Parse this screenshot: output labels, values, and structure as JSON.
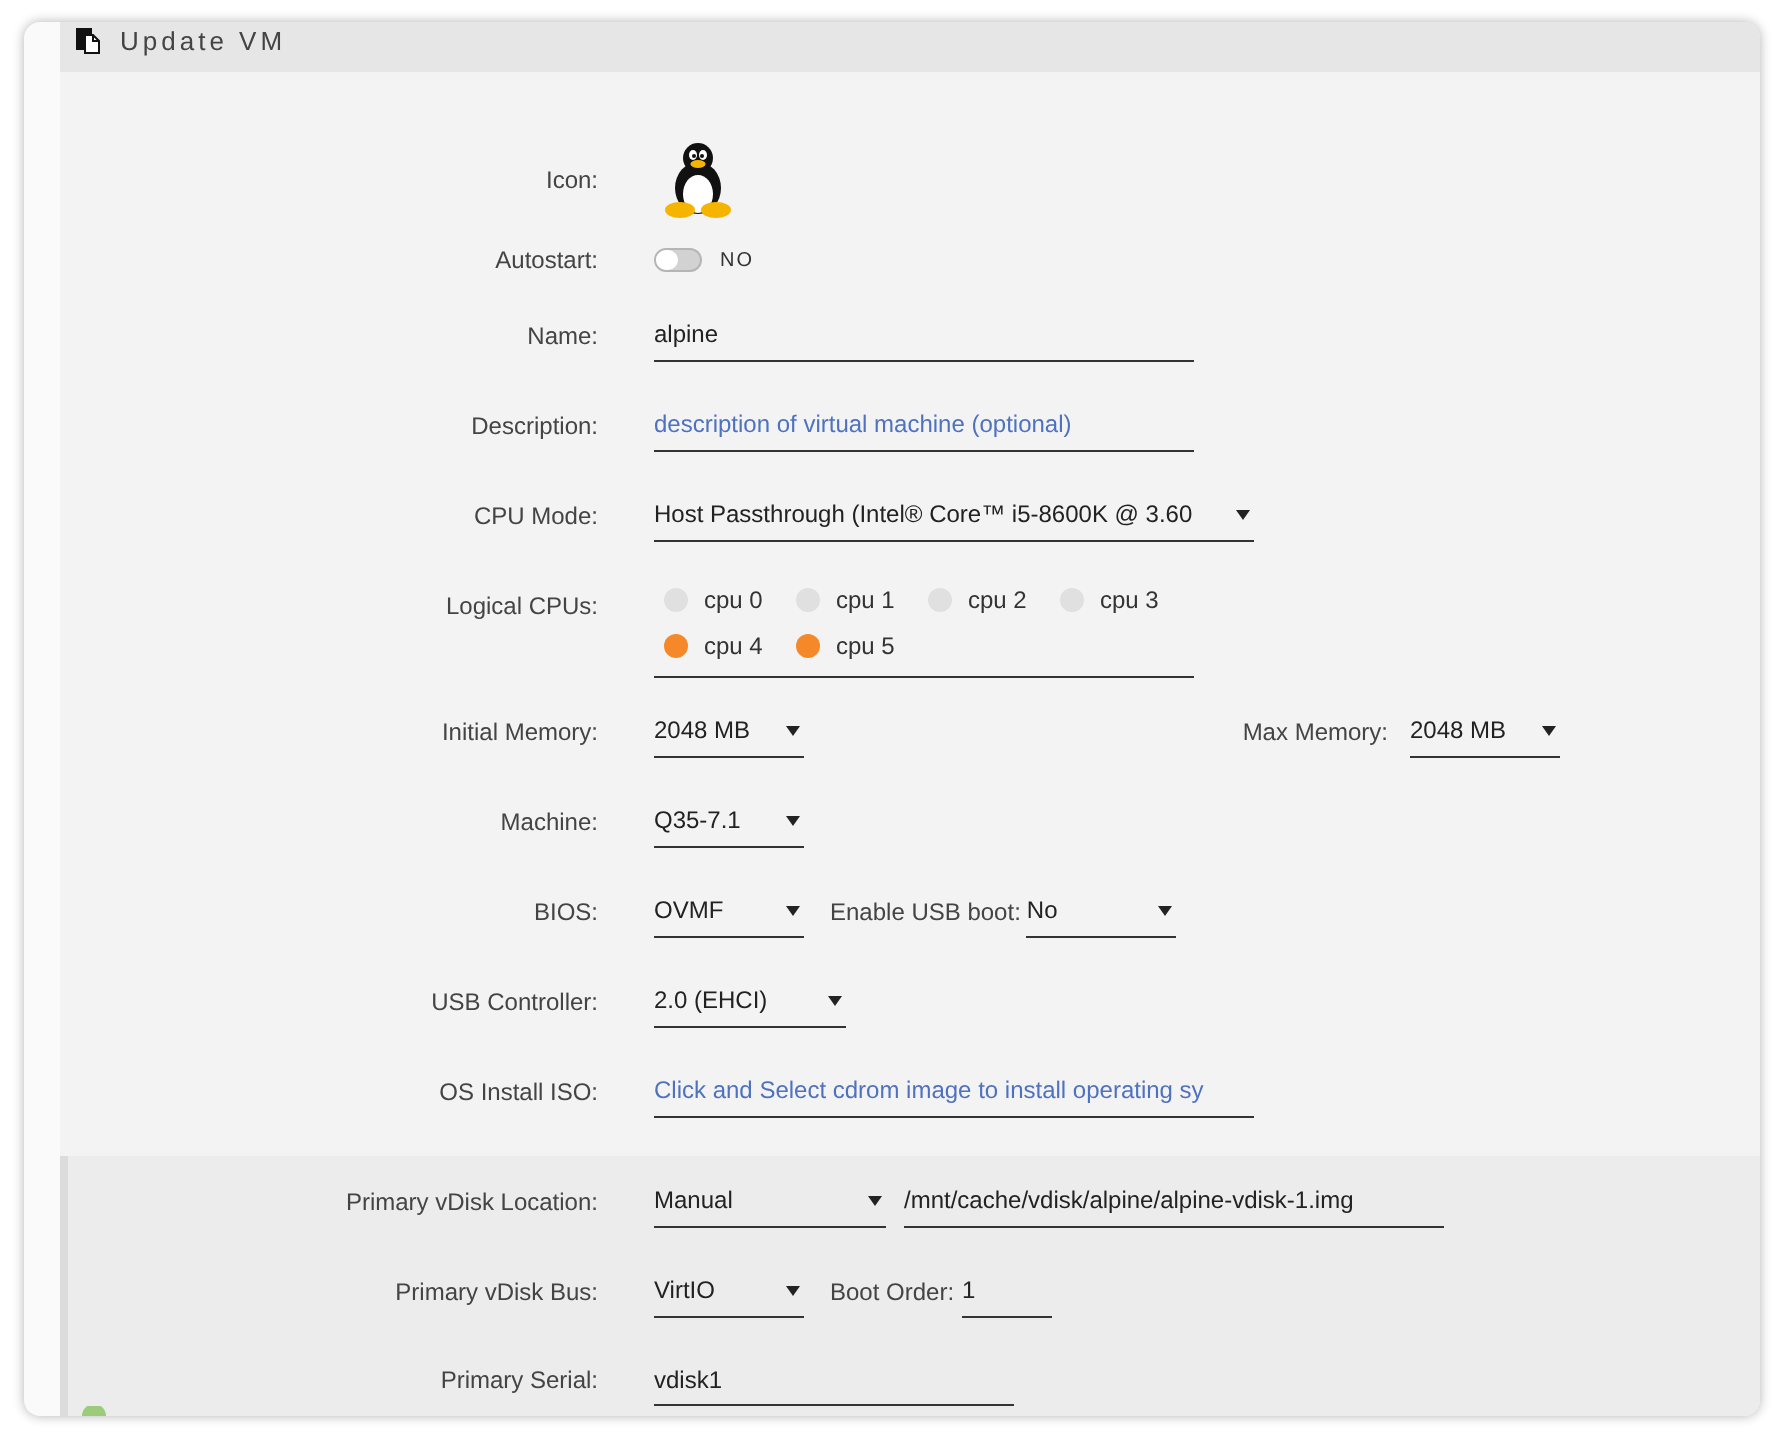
{
  "header": {
    "title": "Update VM"
  },
  "general": {
    "icon": {
      "label": "Icon:"
    },
    "autostart": {
      "label": "Autostart:",
      "on": false,
      "text": "NO"
    },
    "name": {
      "label": "Name:",
      "value": "alpine"
    },
    "description": {
      "label": "Description:",
      "placeholder": "description of virtual machine (optional)"
    },
    "cpu_mode": {
      "label": "CPU Mode:",
      "value": "Host Passthrough (Intel® Core™ i5-8600K @ 3.60"
    },
    "logical_cpus": {
      "label": "Logical CPUs:",
      "items": [
        {
          "label": "cpu 0",
          "checked": false
        },
        {
          "label": "cpu 1",
          "checked": false
        },
        {
          "label": "cpu 2",
          "checked": false
        },
        {
          "label": "cpu 3",
          "checked": false
        },
        {
          "label": "cpu 4",
          "checked": true
        },
        {
          "label": "cpu 5",
          "checked": true
        }
      ]
    },
    "initial_memory": {
      "label": "Initial Memory:",
      "value": "2048 MB"
    },
    "max_memory": {
      "label": "Max Memory:",
      "value": "2048 MB"
    },
    "machine": {
      "label": "Machine:",
      "value": "Q35-7.1"
    },
    "bios": {
      "label": "BIOS:",
      "value": "OVMF"
    },
    "usb_boot": {
      "label": "Enable USB boot:",
      "value": "No"
    },
    "usb_controller": {
      "label": "USB Controller:",
      "value": "2.0 (EHCI)"
    },
    "os_install_iso": {
      "label": "OS Install ISO:",
      "placeholder": "Click and Select cdrom image to install operating sy"
    }
  },
  "primary_vdisk": {
    "location": {
      "label": "Primary vDisk Location:",
      "value": "Manual",
      "path": "/mnt/cache/vdisk/alpine/alpine-vdisk-1.img"
    },
    "bus": {
      "label": "Primary vDisk Bus:",
      "value": "VirtIO"
    },
    "boot_order": {
      "label": "Boot Order:",
      "value": "1"
    },
    "serial": {
      "label": "Primary Serial:",
      "value": "vdisk1"
    }
  }
}
